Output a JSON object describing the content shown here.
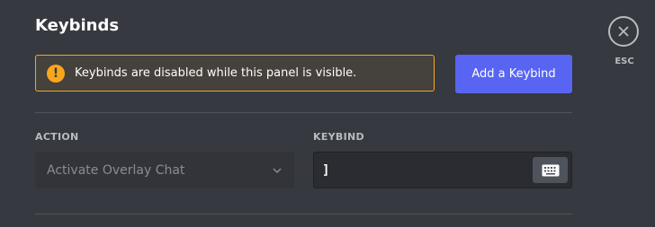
{
  "header": {
    "title": "Keybinds"
  },
  "warning": {
    "icon": "warning-icon",
    "icon_glyph": "!",
    "text": "Keybinds are disabled while this panel is visible.",
    "color": "#faa61a"
  },
  "actions": {
    "add_keybind_label": "Add a Keybind",
    "accent_color": "#5865f2"
  },
  "table": {
    "columns": {
      "action": "ACTION",
      "keybind": "KEYBIND"
    },
    "rows": [
      {
        "action": "Activate Overlay Chat",
        "action_disabled": true,
        "keybind": "]"
      }
    ]
  },
  "close": {
    "label": "ESC",
    "icon": "close-icon"
  },
  "icons": {
    "select": "chevron-down-icon",
    "record": "keyboard-icon"
  }
}
